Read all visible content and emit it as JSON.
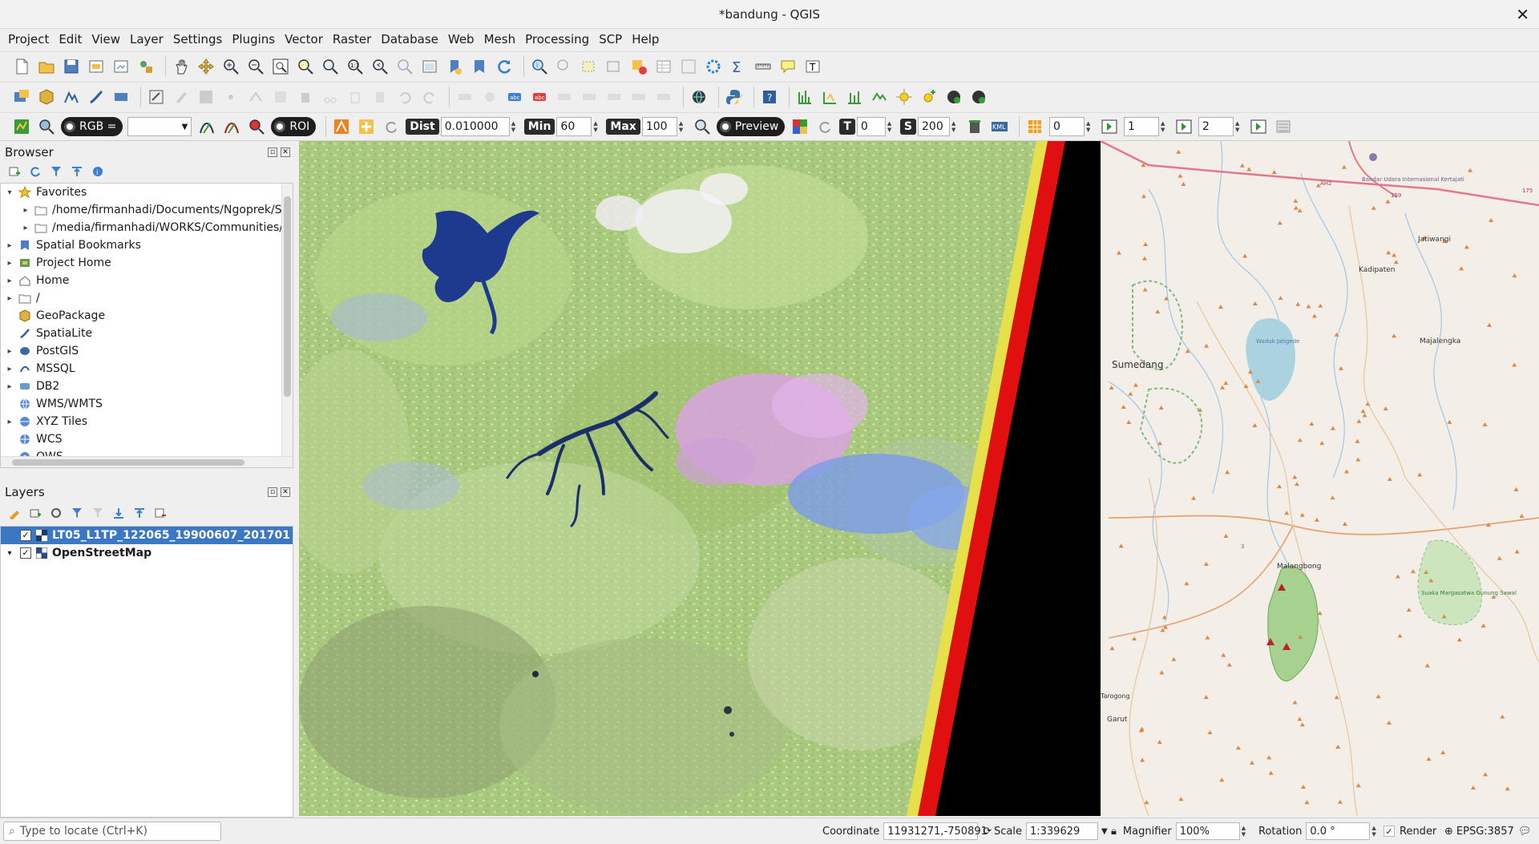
{
  "window": {
    "title": "*bandung - QGIS",
    "close_glyph": "✕"
  },
  "menubar": {
    "items": [
      "Project",
      "Edit",
      "View",
      "Layer",
      "Settings",
      "Plugins",
      "Vector",
      "Raster",
      "Database",
      "Web",
      "Mesh",
      "Processing",
      "SCP",
      "Help"
    ]
  },
  "scp_toolbar": {
    "rgb_label": "RGB =",
    "roi_label": "ROI",
    "dist_label": "Dist",
    "dist_value": "0.010000",
    "min_label": "Min",
    "min_value": "60",
    "max_label": "Max",
    "max_value": "100",
    "preview_label": "Preview",
    "t_label": "T",
    "t_value": "0",
    "s_label": "S",
    "s_value": "200",
    "kml_label": "KML",
    "band_a_value": "0",
    "band_b_value": "1",
    "band_c_value": "2"
  },
  "browser": {
    "title": "Browser",
    "items": [
      {
        "label": "Favorites",
        "arrow": "▾",
        "icon": "star-icon"
      },
      {
        "label": "/home/firmanhadi/Documents/Ngoprek/Ser",
        "arrow": "▸",
        "icon": "folder-icon",
        "indent": 1
      },
      {
        "label": "/media/firmanhadi/WORKS/Communities/Co",
        "arrow": "▸",
        "icon": "folder-icon",
        "indent": 1
      },
      {
        "label": "Spatial Bookmarks",
        "arrow": "▸",
        "icon": "bookmark-icon"
      },
      {
        "label": "Project Home",
        "arrow": "▸",
        "icon": "project-home-icon"
      },
      {
        "label": "Home",
        "arrow": "▸",
        "icon": "home-icon"
      },
      {
        "label": "/",
        "arrow": "▸",
        "icon": "folder-icon"
      },
      {
        "label": "GeoPackage",
        "arrow": "",
        "icon": "geopackage-icon"
      },
      {
        "label": "SpatiaLite",
        "arrow": "",
        "icon": "spatialite-icon"
      },
      {
        "label": "PostGIS",
        "arrow": "▸",
        "icon": "postgis-icon"
      },
      {
        "label": "MSSQL",
        "arrow": "▸",
        "icon": "mssql-icon"
      },
      {
        "label": "DB2",
        "arrow": "▸",
        "icon": "db2-icon"
      },
      {
        "label": "WMS/WMTS",
        "arrow": "",
        "icon": "wms-icon"
      },
      {
        "label": "XYZ Tiles",
        "arrow": "▸",
        "icon": "xyz-tiles-icon"
      },
      {
        "label": "WCS",
        "arrow": "",
        "icon": "wcs-icon"
      },
      {
        "label": "OWS",
        "arrow": "",
        "icon": "ows-icon"
      }
    ]
  },
  "layers": {
    "title": "Layers",
    "items": [
      {
        "label": "LT05_L1TP_122065_19900607_201701",
        "checked": "✓",
        "selected": true
      },
      {
        "label": "OpenStreetMap",
        "checked": "✓",
        "selected": false
      }
    ]
  },
  "map": {
    "place_labels": [
      "Sumedang",
      "Kadipaten",
      "Majalengka",
      "Jatiwangi",
      "Malangbong",
      "Garut",
      "Tarogong",
      "Waduk Jatigede",
      "Bandar Udara Internasional Kertajati",
      "Suaka Margasatwa Gunung Sawal"
    ],
    "road_labels": [
      "AH2",
      "159",
      "175",
      "3"
    ]
  },
  "statusbar": {
    "locate_placeholder": "Type to locate (Ctrl+K)",
    "coordinate_label": "Coordinate",
    "coordinate_value": "11931271,-750891",
    "scale_label": "Scale",
    "scale_value": "1:339629",
    "magnifier_label": "Magnifier",
    "magnifier_value": "100%",
    "rotation_label": "Rotation",
    "rotation_value": "0.0 °",
    "render_label": "Render",
    "crs_label": "EPSG:3857"
  },
  "colors": {
    "accent": "#3b78c4",
    "water_satellite": "#1d3a8f",
    "osm_water": "#aad3df",
    "osm_forest": "#add19e",
    "osm_background": "#f3efe8"
  }
}
